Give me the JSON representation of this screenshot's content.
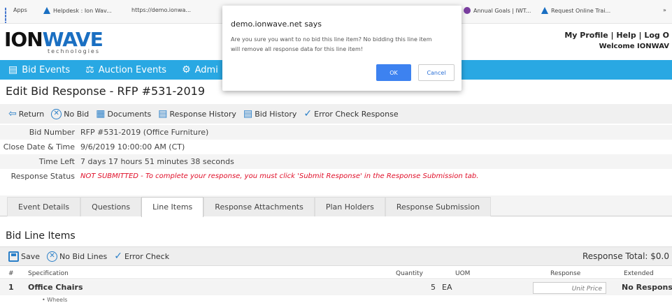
{
  "bookmarks": [
    {
      "label": "Apps",
      "icon": "apps-icon"
    },
    {
      "label": "Helpdesk : Ion Wav...",
      "icon": "ionwave-icon"
    },
    {
      "label": "https://demo.ionwa...",
      "icon": "page-icon"
    },
    {
      "label": "Annual Goals | IWT...",
      "icon": "goals-icon"
    },
    {
      "label": "Request Online Trai...",
      "icon": "ionwave-icon"
    },
    {
      "label": "»",
      "icon": "more-icon"
    }
  ],
  "header": {
    "logo_main": "ION",
    "logo_wave": "WAVE",
    "logo_sub": "technologies",
    "user_links": "My Profile | Help | Log O",
    "welcome": "Welcome IONWAV"
  },
  "nav": {
    "items": [
      {
        "label": "Bid Events",
        "icon": "document-icon"
      },
      {
        "label": "Auction Events",
        "icon": "auction-icon"
      },
      {
        "label": "Admi",
        "icon": "gear-icon"
      }
    ]
  },
  "page": {
    "title": "Edit Bid Response - RFP #531-2019"
  },
  "actions": [
    {
      "label": "Return",
      "icon": "return-icon"
    },
    {
      "label": "No Bid",
      "icon": "no-bid-icon"
    },
    {
      "label": "Documents",
      "icon": "documents-icon"
    },
    {
      "label": "Response History",
      "icon": "history-icon"
    },
    {
      "label": "Bid History",
      "icon": "history-icon"
    },
    {
      "label": "Error Check Response",
      "icon": "check-icon"
    }
  ],
  "details": [
    {
      "label": "Bid Number",
      "value": "RFP #531-2019 (Office Furniture)"
    },
    {
      "label": "Close Date & Time",
      "value": "9/6/2019 10:00:00 AM (CT)"
    },
    {
      "label": "Time Left",
      "value": "7 days 17 hours 51 minutes 38 seconds"
    },
    {
      "label": "Response Status",
      "value": "NOT SUBMITTED - To complete your response, you must click 'Submit Response' in the Response Submission tab."
    }
  ],
  "tabs": [
    {
      "label": "Event Details",
      "active": false
    },
    {
      "label": "Questions",
      "active": false
    },
    {
      "label": "Line Items",
      "active": true
    },
    {
      "label": "Response Attachments",
      "active": false
    },
    {
      "label": "Plan Holders",
      "active": false
    },
    {
      "label": "Response Submission",
      "active": false
    }
  ],
  "line_items": {
    "section_title": "Bid Line Items",
    "save_label": "Save",
    "no_bid_label": "No Bid Lines",
    "error_check_label": "Error Check",
    "response_total": "Response Total: $0.0",
    "columns": {
      "num": "#",
      "spec": "Specification",
      "qty": "Quantity",
      "uom": "UOM",
      "response": "Response",
      "extended": "Extended"
    },
    "rows": [
      {
        "num": "1",
        "spec": "Office Chairs",
        "qty": "5",
        "uom": "EA",
        "response_placeholder": "Unit Price",
        "extended": "No Response"
      }
    ],
    "sub_text": "• Wheels"
  },
  "dialog": {
    "title": "demo.ionwave.net says",
    "message": "Are you sure you want to no bid this line item? No bidding this line item will remove all response data for this line item!",
    "ok_label": "OK",
    "cancel_label": "Cancel"
  },
  "colors": {
    "nav_bg": "#29a8e3",
    "accent": "#2a7fc8",
    "status_red": "#e0102a",
    "ok_button": "#3d82f0"
  }
}
